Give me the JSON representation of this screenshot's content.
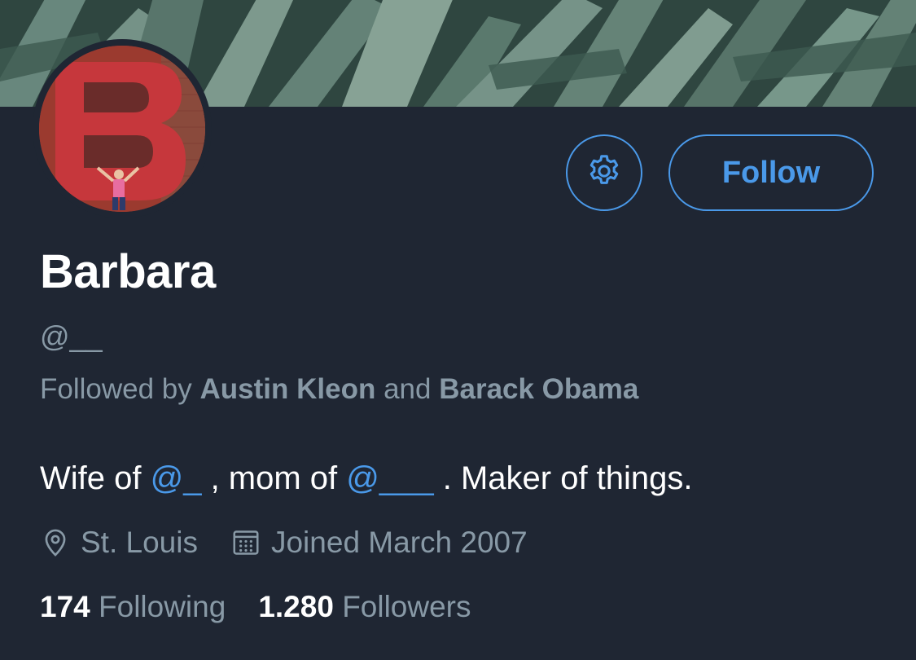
{
  "profile": {
    "display_name": "Barbara",
    "handle": "@__",
    "followed_by": {
      "prefix": "Followed by",
      "first": "Austin Kleon",
      "conjunction": "and",
      "second": "Barack Obama"
    },
    "bio": {
      "part1": "Wife of ",
      "mention1": "@_",
      "part2": " , mom of ",
      "mention2": "@___",
      "part3": " . Maker of things."
    },
    "location": "St. Louis",
    "joined": "Joined March 2007",
    "following_count": "174",
    "following_label": "Following",
    "followers_count": "1.280",
    "followers_label": "Followers"
  },
  "actions": {
    "follow_label": "Follow",
    "settings_icon": "gear-icon"
  },
  "icons": {
    "location": "location-pin-icon",
    "joined": "calendar-icon"
  },
  "colors": {
    "background": "#1f2633",
    "accent": "#4a99e9",
    "secondary_text": "#8899a6",
    "primary_text": "#ffffff"
  }
}
